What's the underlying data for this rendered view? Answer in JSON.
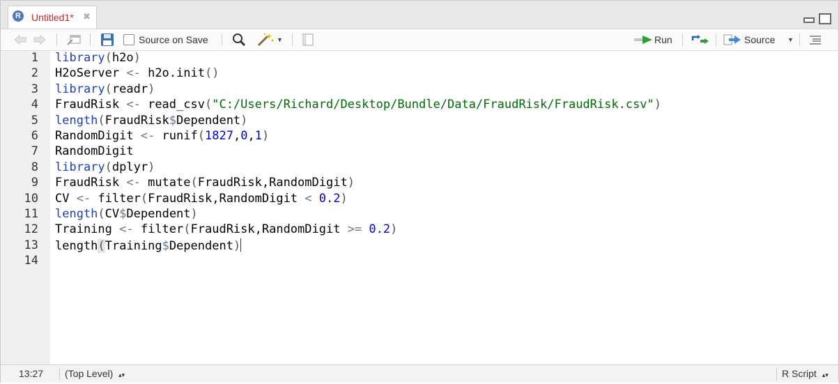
{
  "tab": {
    "title": "Untitled1*"
  },
  "toolbar": {
    "source_on_save": "Source on Save",
    "run": "Run",
    "source": "Source"
  },
  "editor": {
    "line_numbers": [
      "1",
      "2",
      "3",
      "4",
      "5",
      "6",
      "7",
      "8",
      "9",
      "10",
      "11",
      "12",
      "13",
      "14"
    ],
    "lines": [
      [
        {
          "t": "library",
          "c": "kw"
        },
        {
          "t": "(",
          "c": "pn"
        },
        {
          "t": "h2o"
        },
        {
          "t": ")",
          "c": "pn"
        }
      ],
      [
        {
          "t": "H2oServer "
        },
        {
          "t": "<-",
          "c": "op"
        },
        {
          "t": " h2o.init"
        },
        {
          "t": "()",
          "c": "pn"
        }
      ],
      [
        {
          "t": "library",
          "c": "kw"
        },
        {
          "t": "(",
          "c": "pn"
        },
        {
          "t": "readr"
        },
        {
          "t": ")",
          "c": "pn"
        }
      ],
      [
        {
          "t": "FraudRisk "
        },
        {
          "t": "<-",
          "c": "op"
        },
        {
          "t": " read_csv"
        },
        {
          "t": "(",
          "c": "pn"
        },
        {
          "t": "\"C:/Users/Richard/Desktop/Bundle/Data/FraudRisk/FraudRisk.csv\"",
          "c": "str"
        },
        {
          "t": ")",
          "c": "pn"
        }
      ],
      [
        {
          "t": "length",
          "c": "kw"
        },
        {
          "t": "(",
          "c": "pn"
        },
        {
          "t": "FraudRisk"
        },
        {
          "t": "$",
          "c": "op"
        },
        {
          "t": "Dependent"
        },
        {
          "t": ")",
          "c": "pn"
        }
      ],
      [
        {
          "t": "RandomDigit "
        },
        {
          "t": "<-",
          "c": "op"
        },
        {
          "t": " runif"
        },
        {
          "t": "(",
          "c": "pn"
        },
        {
          "t": "1827",
          "c": "num"
        },
        {
          "t": ","
        },
        {
          "t": "0",
          "c": "num"
        },
        {
          "t": ","
        },
        {
          "t": "1",
          "c": "num"
        },
        {
          "t": ")",
          "c": "pn"
        }
      ],
      [
        {
          "t": "RandomDigit"
        }
      ],
      [
        {
          "t": "library",
          "c": "kw"
        },
        {
          "t": "(",
          "c": "pn"
        },
        {
          "t": "dplyr"
        },
        {
          "t": ")",
          "c": "pn"
        }
      ],
      [
        {
          "t": "FraudRisk "
        },
        {
          "t": "<-",
          "c": "op"
        },
        {
          "t": " mutate"
        },
        {
          "t": "(",
          "c": "pn"
        },
        {
          "t": "FraudRisk,RandomDigit"
        },
        {
          "t": ")",
          "c": "pn"
        }
      ],
      [
        {
          "t": "CV "
        },
        {
          "t": "<-",
          "c": "op"
        },
        {
          "t": " filter"
        },
        {
          "t": "(",
          "c": "pn"
        },
        {
          "t": "FraudRisk,RandomDigit "
        },
        {
          "t": "<",
          "c": "op"
        },
        {
          "t": " "
        },
        {
          "t": "0.2",
          "c": "num"
        },
        {
          "t": ")",
          "c": "pn"
        }
      ],
      [
        {
          "t": "length",
          "c": "kw"
        },
        {
          "t": "(",
          "c": "pn"
        },
        {
          "t": "CV"
        },
        {
          "t": "$",
          "c": "op"
        },
        {
          "t": "Dependent"
        },
        {
          "t": ")",
          "c": "pn"
        }
      ],
      [
        {
          "t": "Training "
        },
        {
          "t": "<-",
          "c": "op"
        },
        {
          "t": " filter"
        },
        {
          "t": "(",
          "c": "pn"
        },
        {
          "t": "FraudRisk,RandomDigit "
        },
        {
          "t": ">=",
          "c": "op"
        },
        {
          "t": " "
        },
        {
          "t": "0.2",
          "c": "num"
        },
        {
          "t": ")",
          "c": "pn"
        }
      ],
      [
        {
          "t": "length"
        },
        {
          "t": "(",
          "c": "pn hlp"
        },
        {
          "t": "Training"
        },
        {
          "t": "$",
          "c": "op"
        },
        {
          "t": "Dependent"
        },
        {
          "t": ")",
          "c": "pn"
        },
        {
          "cursor": true
        }
      ],
      []
    ]
  },
  "status": {
    "position": "13:27",
    "scope": "(Top Level)",
    "file_type": "R Script"
  }
}
